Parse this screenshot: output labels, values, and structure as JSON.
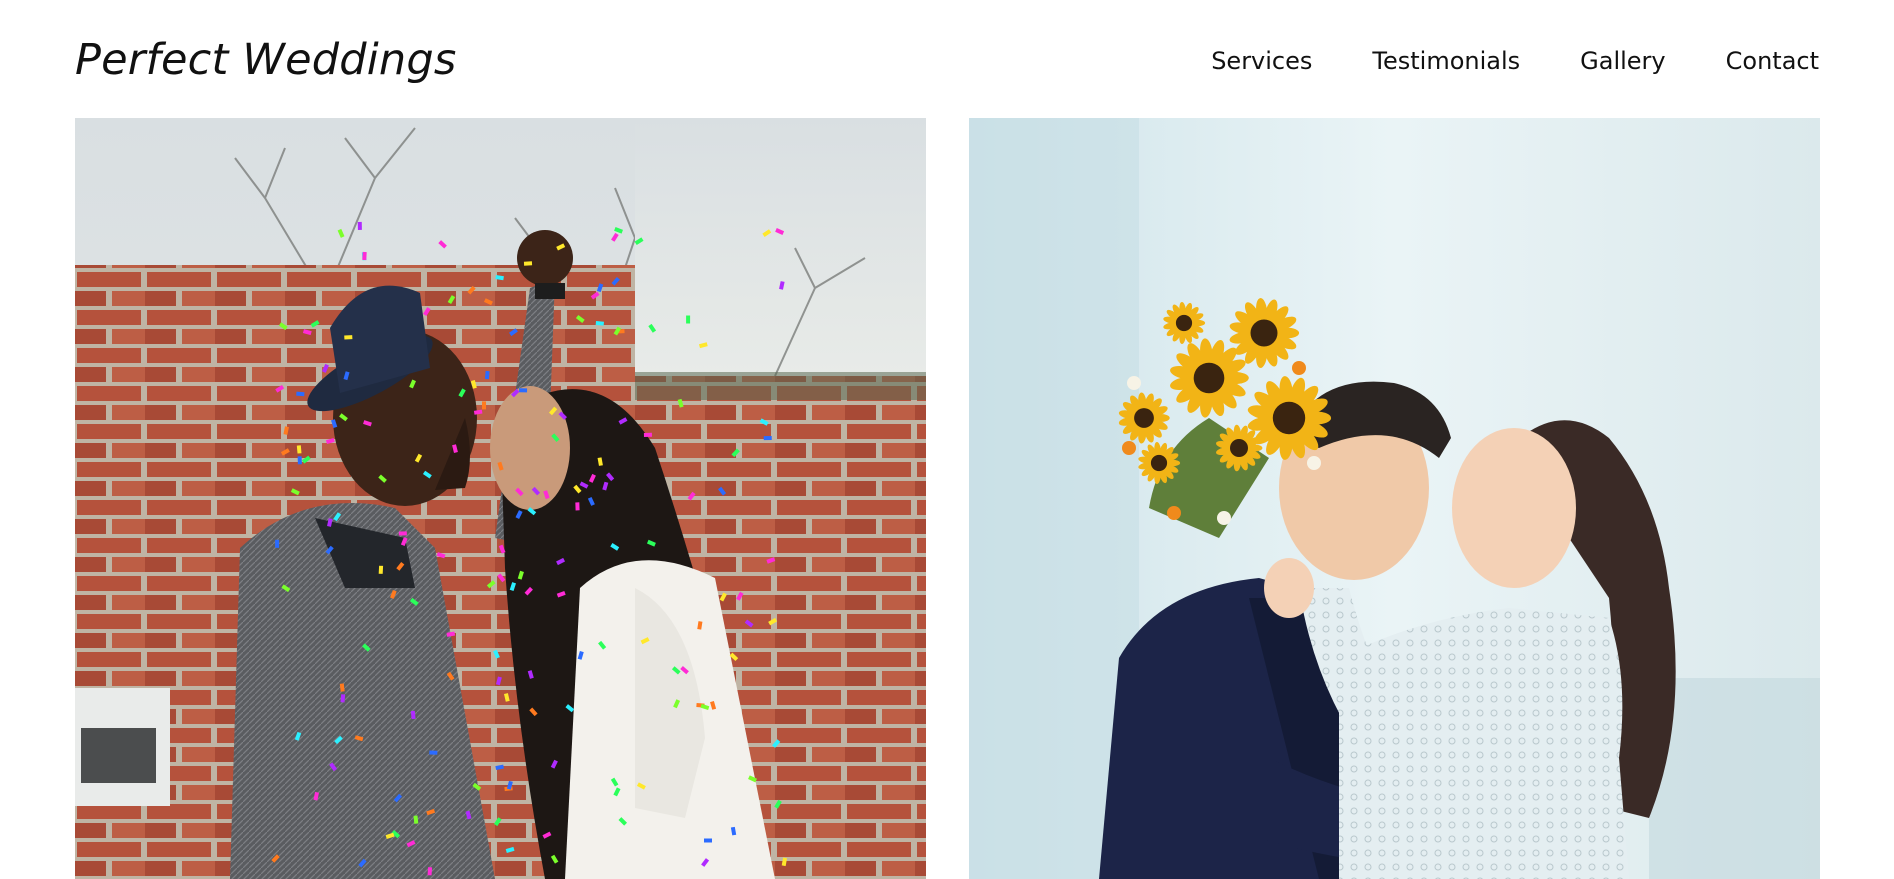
{
  "header": {
    "brand": "Perfect Weddings"
  },
  "nav": {
    "items": [
      {
        "label": "Services"
      },
      {
        "label": "Testimonials"
      },
      {
        "label": "Gallery"
      },
      {
        "label": "Contact"
      }
    ]
  },
  "gallery": {
    "photos": [
      {
        "subject": "couple-kissing-under-confetti-by-brick-wall"
      },
      {
        "subject": "bride-and-groom-with-sunflower-bouquet"
      }
    ]
  },
  "colors": {
    "text": "#111111",
    "background": "#ffffff",
    "brick": "#b5523c",
    "sky": "#e3e8e6",
    "sunflower": "#f2b416",
    "suit": "#1c2448",
    "lace": "#e6f0f2"
  }
}
